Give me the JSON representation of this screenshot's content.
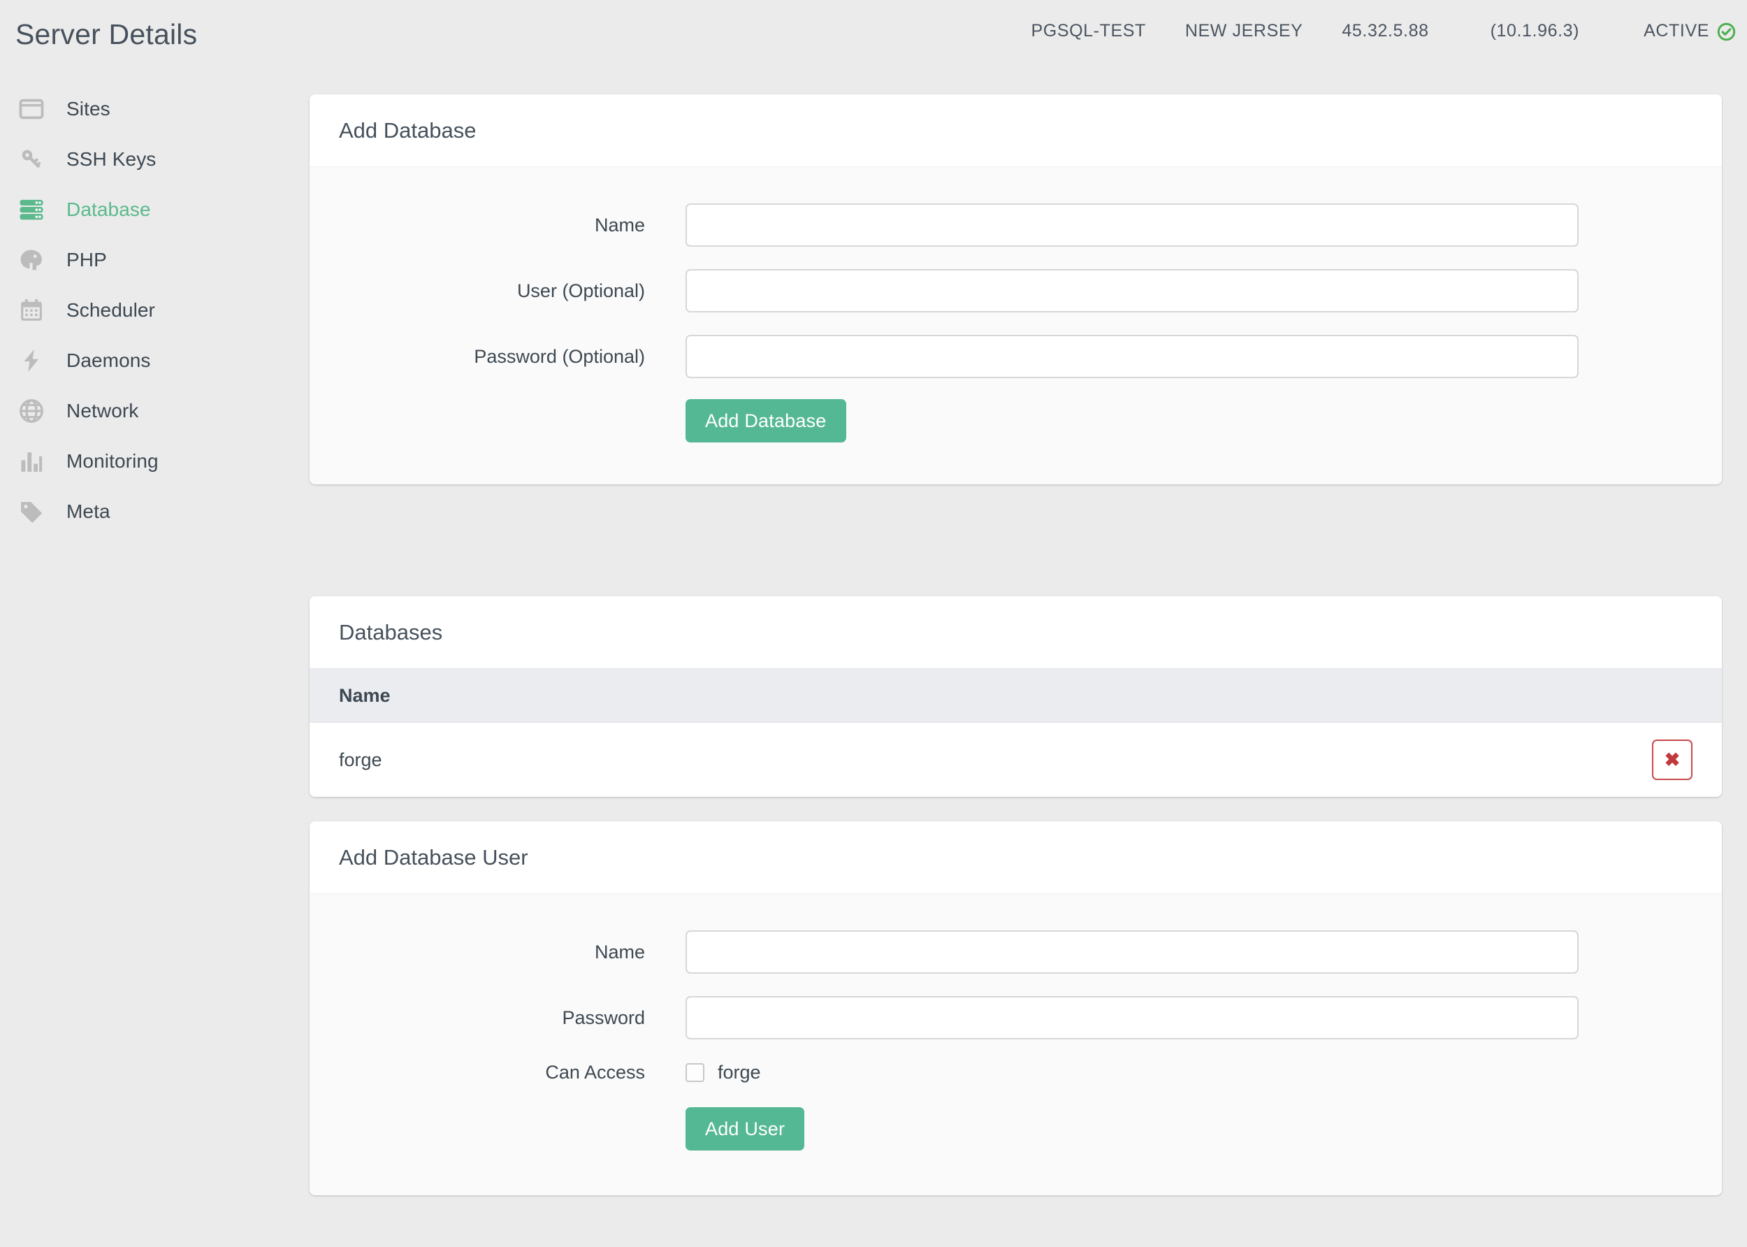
{
  "header": {
    "title": "Server Details",
    "server_name": "PGSQL-TEST",
    "region": "NEW JERSEY",
    "public_ip": "45.32.5.88",
    "private_ip": "(10.1.96.3)",
    "status": "ACTIVE",
    "status_icon": "check-circle-icon",
    "status_color": "#4caf50"
  },
  "sidebar": {
    "items": [
      {
        "label": "Sites",
        "icon": "window-icon",
        "active": false
      },
      {
        "label": "SSH Keys",
        "icon": "key-icon",
        "active": false
      },
      {
        "label": "Database",
        "icon": "server-stack-icon",
        "active": true
      },
      {
        "label": "PHP",
        "icon": "elephant-icon",
        "active": false
      },
      {
        "label": "Scheduler",
        "icon": "calendar-icon",
        "active": false
      },
      {
        "label": "Daemons",
        "icon": "lightning-bolt-icon",
        "active": false
      },
      {
        "label": "Network",
        "icon": "globe-icon",
        "active": false
      },
      {
        "label": "Monitoring",
        "icon": "bar-chart-icon",
        "active": false
      },
      {
        "label": "Meta",
        "icon": "tag-icon",
        "active": false
      }
    ],
    "active_color": "#5bb98c",
    "icon_color": "#bcbcbc"
  },
  "add_database": {
    "title": "Add Database",
    "fields": {
      "name_label": "Name",
      "name_value": "",
      "name_placeholder": "",
      "user_label": "User (Optional)",
      "user_value": "",
      "user_placeholder": "",
      "password_label": "Password (Optional)",
      "password_value": "",
      "password_placeholder": ""
    },
    "submit_label": "Add Database",
    "submit_color": "#55b894"
  },
  "databases": {
    "title": "Databases",
    "columns": [
      "Name"
    ],
    "rows": [
      {
        "name": "forge",
        "delete_icon": "close-x-icon"
      }
    ],
    "delete_color": "#c0393c"
  },
  "add_database_user": {
    "title": "Add Database User",
    "fields": {
      "name_label": "Name",
      "name_value": "",
      "name_placeholder": "",
      "password_label": "Password",
      "password_value": "",
      "password_placeholder": "",
      "can_access_label": "Can Access",
      "can_access_options": [
        {
          "label": "forge",
          "checked": false
        }
      ]
    },
    "submit_label": "Add User",
    "submit_color": "#55b894"
  }
}
